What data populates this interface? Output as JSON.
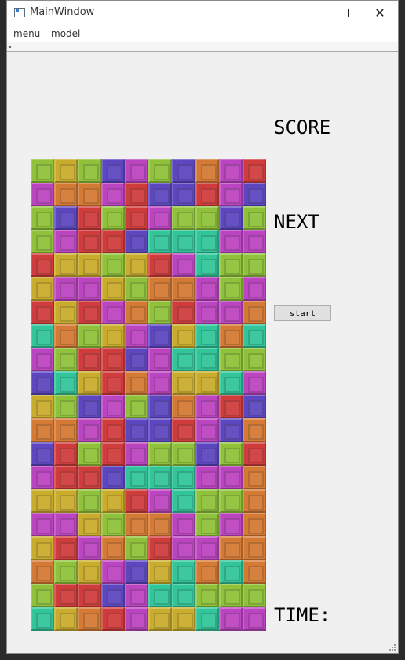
{
  "window": {
    "title": "MainWindow",
    "icon": "app-window-icon",
    "controls": {
      "minimize": "minimize-icon",
      "maximize": "maximize-icon",
      "close": "close-icon",
      "close_glyph": "✕"
    }
  },
  "menubar": {
    "items": [
      "menu",
      "model"
    ]
  },
  "side": {
    "score_label": "SCORE",
    "next_label": "NEXT",
    "start_label": "start",
    "time_label": "TIME:"
  },
  "colors": {
    "G": "#8fc23a",
    "Y": "#c9ac2c",
    "O": "#d47a34",
    "B": "#5d47c0",
    "M": "#bb44c0",
    "R": "#d03c3c",
    "T": "#31c59a"
  },
  "board": {
    "columns": 10,
    "rows": [
      "GYGBMGBOMR",
      "MOOMRBBRMB",
      "GBRGRMGGBG",
      "GMRRBTTTMM",
      "RYYGYRMTGG",
      "YMMYGOOMGM",
      "RYRMOGRMMO",
      "TOGYMBYTOT",
      "MGRRBMTTGG",
      "BTYROMYYTM",
      "YGBMGBOMRB",
      "OOMRBBRMBO",
      "BRGRMGGBGR",
      "MRRBTTTMMO",
      "YYGYRMTGGO",
      "MMYGOOMGMO",
      "YRMOGRMMOO",
      "OGYMBYTOTO",
      "GRRBMTTGGG",
      "TYORMYYTMM"
    ]
  }
}
